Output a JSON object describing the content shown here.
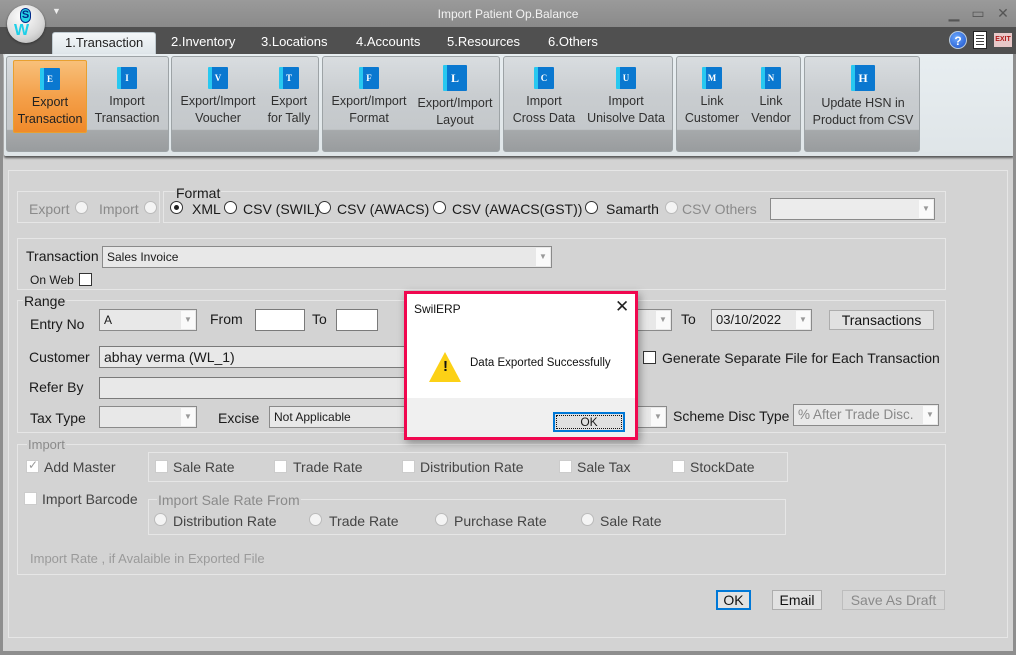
{
  "window": {
    "title": "Import Patient Op.Balance",
    "qat_icon": "dropdown-arrow-icon",
    "controls": {
      "minimize": "▁",
      "maximize": "▭",
      "close": "✕"
    }
  },
  "tabs": [
    {
      "label": "1.Transaction",
      "active": true
    },
    {
      "label": "2.Inventory"
    },
    {
      "label": "3.Locations"
    },
    {
      "label": "4.Accounts"
    },
    {
      "label": "5.Resources"
    },
    {
      "label": "6.Others"
    }
  ],
  "tab_icons": {
    "help": "?",
    "report": "report-icon",
    "exit": "EXIT"
  },
  "ribbon": {
    "buttons": [
      {
        "line1": "Export",
        "line2": "Transaction",
        "glyph": "E",
        "active": true
      },
      {
        "line1": "Import",
        "line2": "Transaction",
        "glyph": "I"
      },
      {
        "line1": "Export/Import",
        "line2": "Voucher",
        "glyph": "V"
      },
      {
        "line1": "Export",
        "line2": "for Tally",
        "glyph": "T"
      },
      {
        "line1": "Export/Import",
        "line2": "Format",
        "glyph": "F"
      },
      {
        "line1": "Export/Import",
        "line2": "Layout",
        "glyph": "L"
      },
      {
        "line1": "Import",
        "line2": "Cross Data",
        "glyph": "C"
      },
      {
        "line1": "Import",
        "line2": "Unisolve Data",
        "glyph": "U"
      },
      {
        "line1": "Link",
        "line2": "Customer",
        "glyph": "M"
      },
      {
        "line1": "Link",
        "line2": "Vendor",
        "glyph": "N"
      },
      {
        "line1": "Update HSN in",
        "line2": "Product from CSV",
        "glyph": "H"
      }
    ]
  },
  "mode": {
    "export_label": "Export",
    "import_label": "Import"
  },
  "format": {
    "label": "Format",
    "options": [
      "XML",
      "CSV (SWIL)",
      "CSV (AWACS)",
      "CSV (AWACS(GST))",
      "Samarth",
      "CSV Others"
    ],
    "selected": "XML",
    "others_select_value": ""
  },
  "transaction": {
    "label": "Transaction",
    "value": "Sales Invoice",
    "on_web_label": "On Web"
  },
  "range": {
    "label": "Range",
    "entry_no_label": "Entry No",
    "entry_no_value": "A",
    "from_label": "From",
    "from_value": "",
    "to_label": "To",
    "to_value": "",
    "date_to_label": "To",
    "date_to_value": "03/10/2022",
    "transactions_button": "Transactions",
    "customer_label": "Customer",
    "customer_value": "abhay verma  (WL_1)",
    "generate_separate_label": "Generate Separate File for Each Transaction",
    "refer_by_label": "Refer By",
    "refer_by_value": "",
    "tax_type_label": "Tax Type",
    "tax_type_value": "",
    "excise_label": "Excise",
    "excise_value": "Not Applicable",
    "scheme_disc_label": "Scheme Disc Type",
    "scheme_disc_value": "% After Trade Disc."
  },
  "import": {
    "label": "Import",
    "add_master_label": "Add Master",
    "rate_checks": [
      "Sale Rate",
      "Trade Rate",
      "Distribution Rate",
      "Sale Tax",
      "StockDate"
    ],
    "import_barcode_label": "Import Barcode",
    "sale_rate_from_label": "Import Sale Rate From",
    "sale_rate_from_options": [
      "Distribution Rate",
      "Trade Rate",
      "Purchase Rate",
      "Sale Rate"
    ],
    "note": "Import Rate , if Avalaible in Exported File"
  },
  "footer": {
    "ok": "OK",
    "email": "Email",
    "save_draft": "Save As Draft"
  },
  "dialog": {
    "title": "SwilERP",
    "message": "Data Exported Successfully",
    "ok": "OK",
    "close": "✕",
    "highlight_color": "#f0074f"
  }
}
